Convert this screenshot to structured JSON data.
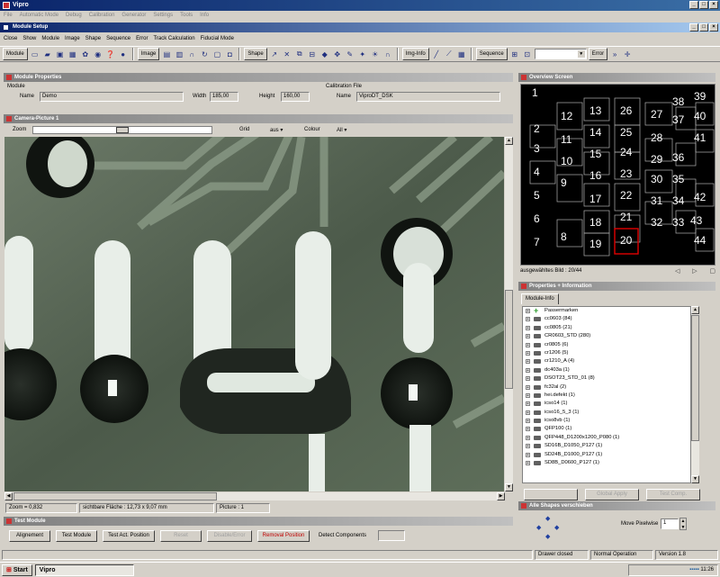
{
  "app": {
    "title": "Vipro",
    "menu": [
      "File",
      "Automatic Mode",
      "Debug",
      "Calibration",
      "Generator",
      "Settings",
      "Tools",
      "Info"
    ]
  },
  "window": {
    "title": "Module Setup",
    "menu": [
      "Close",
      "Show",
      "Module",
      "Image",
      "Shape",
      "Sequence",
      "Error",
      "Track Calculation",
      "Fiducial Mode"
    ]
  },
  "toolbar": {
    "module_label": "Module",
    "image_label": "Image",
    "shape_label": "Shape",
    "img_info_label": "Img-Info",
    "sequence_label": "Sequence",
    "error_label": "Error"
  },
  "module_properties": {
    "title": "Module Properties",
    "module_group": "Module",
    "name_label": "Name",
    "name_value": "Demo",
    "width_label": "Width",
    "width_value": "185,00",
    "height_label": "Height",
    "height_value": "160,00",
    "calib_group": "Calibration File",
    "calib_name_label": "Name",
    "calib_name_value": "ViproDT_DSK"
  },
  "camera": {
    "title": "Camera-Picture 1",
    "zoom_label": "Zoom",
    "grid_label": "Grid",
    "grid_value": "aus",
    "colour_label": "Colour",
    "colour_value": "All",
    "status_zoom": "Zoom = 0,832",
    "status_area": "sichtbare Fläche : 12,73 x 9,07 mm",
    "status_picture": "Picture : 1"
  },
  "overview": {
    "title": "Overview Screen",
    "status": "ausgewähltes Bild : 20/44",
    "cells": [
      "1",
      "2",
      "3",
      "4",
      "5",
      "6",
      "7",
      "8",
      "9",
      "10",
      "11",
      "12",
      "13",
      "14",
      "15",
      "16",
      "17",
      "18",
      "19",
      "20",
      "21",
      "22",
      "23",
      "24",
      "25",
      "26",
      "27",
      "28",
      "29",
      "30",
      "31",
      "32",
      "33",
      "34",
      "35",
      "36",
      "37",
      "38",
      "39",
      "40",
      "41",
      "42",
      "43",
      "44"
    ]
  },
  "properties": {
    "title": "Properties + Information",
    "tab": "Module-Info",
    "items": [
      "Passermarken",
      "cc0603 (84)",
      "cc0805 (21)",
      "CR0603_STD (280)",
      "cr0805 (6)",
      "cr1206 (5)",
      "cr1210_A (4)",
      "dc403a (1)",
      "DSOT23_STD_01 (8)",
      "fc32al (2)",
      "hei.defekt (1)",
      "icso14 (1)",
      "icso16_5_3 (1)",
      "icso8vb (1)",
      "QFP100 (1)",
      "QFP448_D1200x1200_P080 (1)",
      "SD16B_D1050_P127 (1)",
      "SD24B_D1000_P127 (1)",
      "SD8B_D0600_P127 (1)"
    ],
    "buttons": [
      "",
      "Global Apply",
      "Test Comp."
    ]
  },
  "shapes_panel": {
    "title": "Alle Shapes verschieben",
    "move_label": "Move Pixelwise",
    "move_value": "1"
  },
  "test_module": {
    "title": "Test Module",
    "buttons": [
      "Alignement",
      "Test Module",
      "Test Act. Position",
      "Reset",
      "Disable/Error",
      "Removal Position"
    ],
    "detect_label": "Detect Components"
  },
  "statusbar": {
    "drawer": "Drawer closed",
    "mode": "Normal Operation",
    "version": "Version 1.8"
  },
  "taskbar": {
    "start": "Start",
    "task": "Vipro",
    "clock": "11:26"
  },
  "colors": {
    "title_active": "#0a246a",
    "title_inactive": "#808080",
    "face": "#d4d0c8"
  }
}
